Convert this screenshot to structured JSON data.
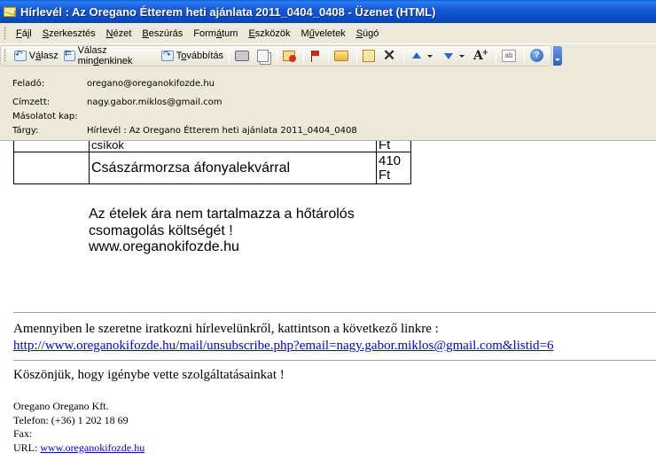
{
  "window": {
    "title": "Hírlevél : Az Oregano Étterem heti ajánlata 2011_0404_0408 - Üzenet (HTML)"
  },
  "menubar": {
    "items": [
      {
        "pre": "",
        "key": "F",
        "post": "ájl"
      },
      {
        "pre": "",
        "key": "S",
        "post": "zerkesztés"
      },
      {
        "pre": "",
        "key": "N",
        "post": "ézet"
      },
      {
        "pre": "",
        "key": "B",
        "post": "eszúrás"
      },
      {
        "pre": "Form",
        "key": "á",
        "post": "tum"
      },
      {
        "pre": "",
        "key": "E",
        "post": "szközök"
      },
      {
        "pre": "M",
        "key": "ű",
        "post": "veletek"
      },
      {
        "pre": "",
        "key": "S",
        "post": "úgó"
      }
    ]
  },
  "toolbar": {
    "reply": {
      "pre": "V",
      "key": "á",
      "post": "lasz"
    },
    "reply_all": {
      "pre": "Válasz min",
      "key": "d",
      "post": "enkinek"
    },
    "forward": {
      "pre": "T",
      "key": "o",
      "post": "vábbítás"
    },
    "icons": [
      "print-icon",
      "copy-icon",
      "junk-icon",
      "flag-icon",
      "folder-icon",
      "move-icon",
      "delete-icon",
      "previous-icon",
      "next-icon",
      "font-size-icon",
      "address-book-icon",
      "help-icon"
    ]
  },
  "header": {
    "from_label": "Feladó:",
    "from_value": "oregano@oreganokifozde.hu",
    "to_label": "Címzett:",
    "to_value": "nagy.gabor.miklos@gmail.com",
    "cc_label": "Másolatot kap:",
    "cc_value": "",
    "subject_label": "Tárgy:",
    "subject_value": "Hírlevél : Az Oregano Étterem heti ajánlata 2011_0404_0408"
  },
  "body": {
    "table_rows": [
      {
        "name": "csíkok",
        "price": "Ft"
      },
      {
        "name": "Császármorzsa áfonyalekvárral",
        "price_num": "410",
        "price_unit": "Ft"
      }
    ],
    "note_line1": "Az ételek ára nem tartalmazza a hőtárolós",
    "note_line2": "csomagolás költségét !",
    "note_line3": "www.oreganokifozde.hu",
    "unsubscribe_text": "Amennyiben le szeretne iratkozni hírlevelünkről, kattintson a következő linkre :",
    "unsubscribe_link": "http://www.oreganokifozde.hu/mail/unsubscribe.php?email=nagy.gabor.miklos@gmail.com&listid=6",
    "thanks": "Köszönjük, hogy igénybe vette szolgáltatásainkat !",
    "company": "Oregano Oregano Kft.",
    "phone": "Telefon: (+36) 1 202 18 69",
    "fax": "Fax:",
    "url_label": "URL:",
    "url_link": "www.oreganokifozde.hu"
  }
}
